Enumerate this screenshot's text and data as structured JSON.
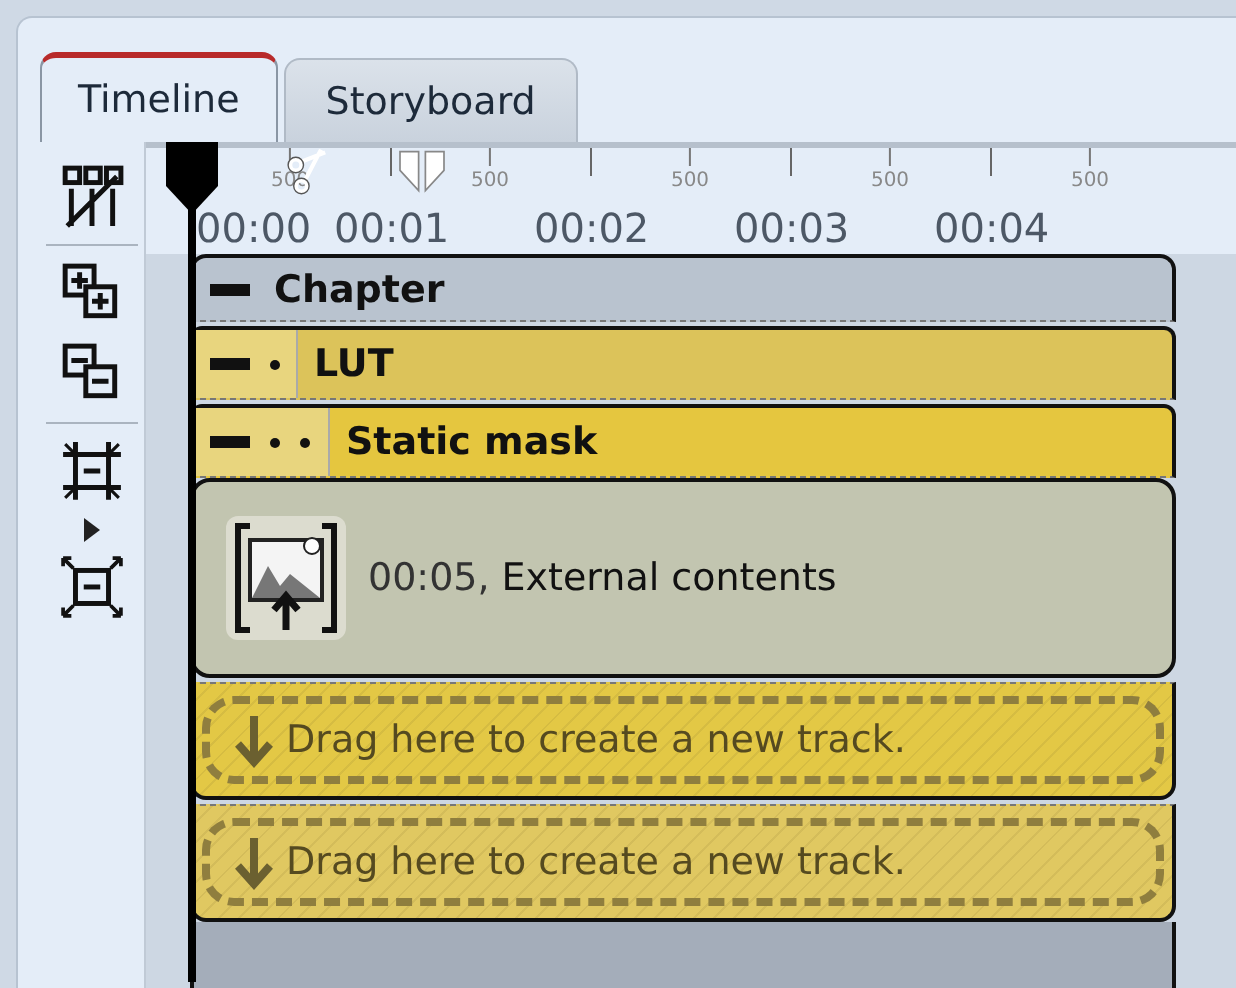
{
  "tabs": [
    {
      "label": "Timeline",
      "selected": true
    },
    {
      "label": "Storyboard",
      "selected": false
    }
  ],
  "toolbar": [
    {
      "kind": "grid-split"
    },
    {
      "kind": "add"
    },
    {
      "kind": "remove"
    },
    {
      "kind": "fit",
      "expander": true
    },
    {
      "kind": "expand"
    }
  ],
  "ruler": {
    "seconds": [
      {
        "label": "00:00",
        "half_label": "500"
      },
      {
        "label": "00:01",
        "half_label": "500"
      },
      {
        "label": "00:02",
        "half_label": "500"
      },
      {
        "label": "00:03",
        "half_label": "500"
      },
      {
        "label": "00:04",
        "half_label": "500"
      }
    ]
  },
  "tracks": [
    {
      "kind": "chapter",
      "label": "Chapter",
      "expanded": true,
      "children": [
        {
          "kind": "effect",
          "label": "LUT",
          "expanded": true,
          "children": [
            {
              "kind": "effect",
              "label": "Static mask",
              "expanded": true,
              "children": [
                {
                  "kind": "clip",
                  "time": "00:05,",
                  "label": "External contents"
                }
              ]
            }
          ]
        }
      ]
    },
    {
      "kind": "drop",
      "label": "Drag here to create a new track."
    },
    {
      "kind": "drop",
      "label": "Drag here to create a new track."
    }
  ]
}
